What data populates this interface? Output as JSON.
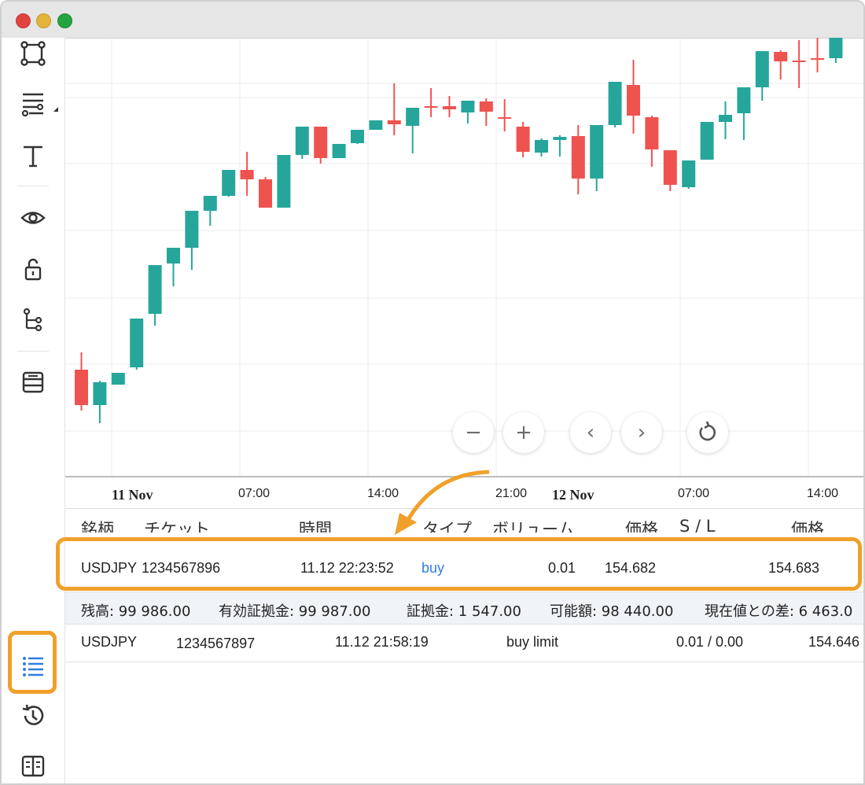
{
  "window": {
    "traffic_lights": [
      "close",
      "minimize",
      "maximize"
    ]
  },
  "toolbar": {
    "tools": [
      "rectangle-icon",
      "lines-settings-icon",
      "text-icon",
      "eye-icon",
      "lock-icon",
      "tree-icon",
      "layers-icon"
    ],
    "bottom_tools": [
      "list-icon",
      "history-icon",
      "journal-icon"
    ],
    "active": "list-icon",
    "accent": "#f0a02a"
  },
  "chart_data": {
    "type": "candlestick",
    "time_labels": [
      {
        "text": "11 Nov",
        "bold": true
      },
      {
        "text": "07:00",
        "bold": false
      },
      {
        "text": "14:00",
        "bold": false
      },
      {
        "text": "21:00",
        "bold": false
      },
      {
        "text": "12 Nov",
        "bold": true
      },
      {
        "text": "07:00",
        "bold": false
      },
      {
        "text": "14:00",
        "bold": false
      }
    ],
    "up_color": "#26a69a",
    "down_color": "#ef5350",
    "candles": [
      [
        468,
        446,
        513,
        520
      ],
      [
        513,
        482,
        484,
        536
      ],
      [
        487,
        472,
        472,
        487
      ],
      [
        465,
        440,
        403,
        468
      ],
      [
        397,
        400,
        335,
        412
      ],
      [
        333,
        329,
        313,
        362
      ],
      [
        313,
        320,
        266,
        341
      ],
      [
        266,
        265,
        247,
        285
      ],
      [
        247,
        246,
        214,
        248
      ],
      [
        214,
        191,
        226,
        247
      ],
      [
        226,
        223,
        262,
        262
      ],
      [
        262,
        288,
        195,
        262
      ],
      [
        195,
        190,
        159,
        200
      ],
      [
        159,
        159,
        199,
        206
      ],
      [
        199,
        218,
        181,
        199
      ],
      [
        180,
        181,
        163,
        181
      ],
      [
        163,
        163,
        151,
        163
      ],
      [
        151,
        104,
        156,
        170
      ],
      [
        158,
        136,
        135,
        193
      ],
      [
        133,
        110,
        133,
        147
      ],
      [
        133,
        120,
        137,
        147
      ],
      [
        141,
        138,
        126,
        155
      ],
      [
        127,
        123,
        140,
        158
      ],
      [
        147,
        124,
        148,
        165
      ],
      [
        159,
        153,
        191,
        198
      ],
      [
        192,
        174,
        176,
        197
      ],
      [
        176,
        170,
        172,
        197
      ],
      [
        171,
        157,
        225,
        245
      ],
      [
        225,
        238,
        157,
        241
      ],
      [
        157,
        144,
        102,
        160
      ],
      [
        106,
        74,
        145,
        168
      ],
      [
        147,
        145,
        188,
        210
      ],
      [
        189,
        190,
        233,
        241
      ],
      [
        236,
        262,
        202,
        238
      ],
      [
        201,
        199,
        153,
        201
      ],
      [
        153,
        127,
        144,
        175
      ],
      [
        142,
        112,
        109,
        176
      ],
      [
        109,
        123,
        63,
        126
      ],
      [
        64,
        62,
        76,
        99
      ],
      [
        75,
        49,
        75,
        110
      ],
      [
        72,
        44,
        72,
        90
      ],
      [
        72,
        48,
        40,
        78
      ]
    ]
  },
  "chart_controls": {
    "zoom_out": "−",
    "zoom_in": "+",
    "prev": "‹",
    "next": "›",
    "reset_icon": "reset-icon"
  },
  "positions": {
    "headers": [
      "銘柄",
      "チケット",
      "時間",
      "タイプ",
      "ボリューム",
      "価格",
      "S / L",
      "価格"
    ],
    "rows": [
      {
        "symbol": "USDJPY",
        "ticket": "1234567896",
        "time": "11.12 22:23:52",
        "type": "buy",
        "volume": "0.01",
        "price": "154.682",
        "current": "154.683"
      }
    ],
    "summary": {
      "balance": "残高: 99 986.00",
      "equity": "有効証拠金: 99 987.00",
      "margin": "証拠金: 1 547.00",
      "free": "可能額: 98 440.00",
      "diff": "現在値との差: 6 463.0"
    },
    "orders": [
      {
        "symbol": "USDJPY",
        "ticket": "1234567897",
        "time": "11.12 21:58:19",
        "type": "buy limit",
        "volume": "0.01 / 0.00",
        "price": "154.646"
      }
    ]
  }
}
